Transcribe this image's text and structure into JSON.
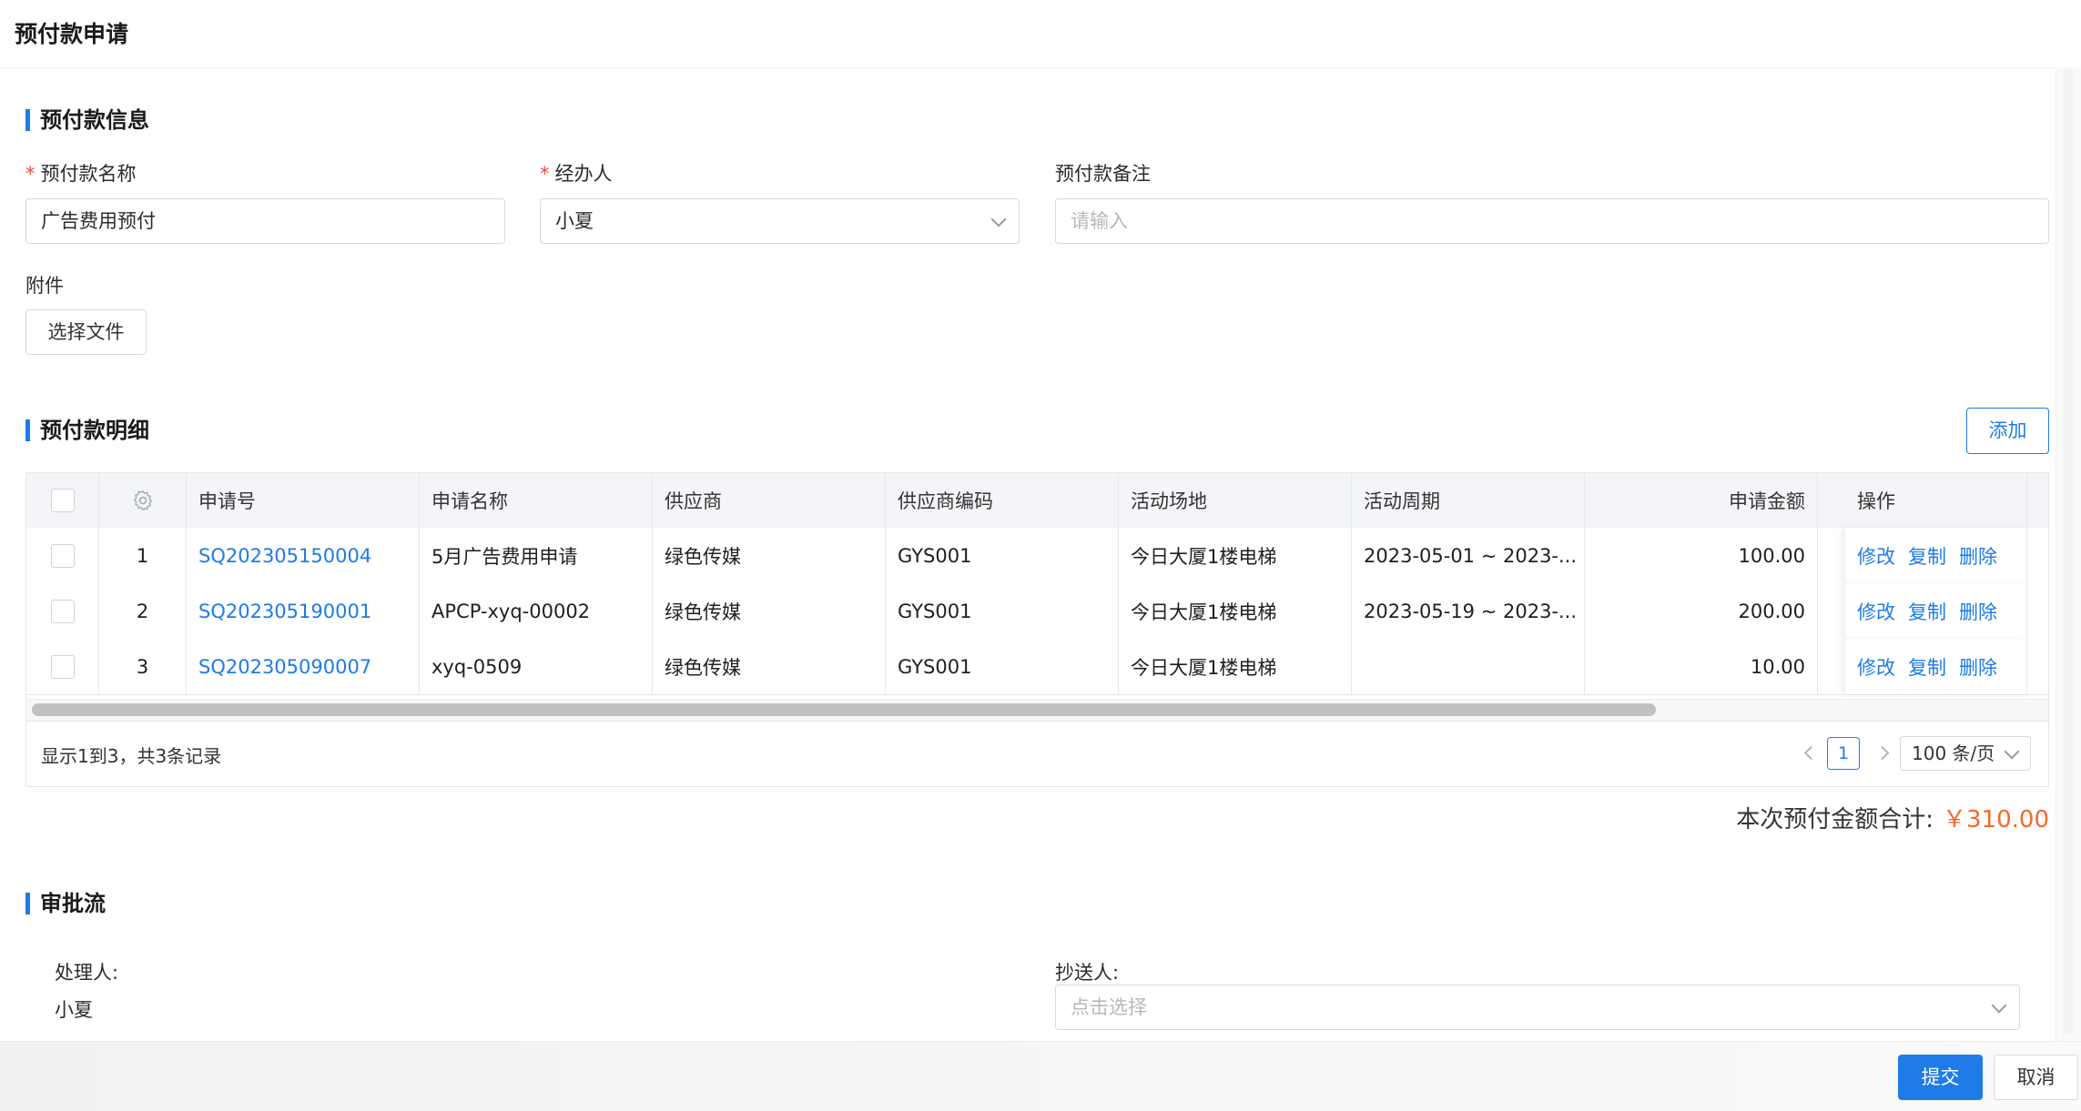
{
  "page": {
    "title": "预付款申请"
  },
  "info_section": {
    "title": "预付款信息",
    "name_label": "预付款名称",
    "name_value": "广告费用预付",
    "handler_label": "经办人",
    "handler_value": "小夏",
    "remark_label": "预付款备注",
    "remark_placeholder": "请输入",
    "attachment_label": "附件",
    "choose_file_label": "选择文件"
  },
  "detail_section": {
    "title": "预付款明细",
    "add_label": "添加",
    "columns": [
      "申请号",
      "申请名称",
      "供应商",
      "供应商编码",
      "活动场地",
      "活动周期",
      "申请金额",
      "操作"
    ],
    "rows": [
      {
        "index": "1",
        "apply_no": "SQ202305150004",
        "apply_name": "5月广告费用申请",
        "supplier": "绿色传媒",
        "supplier_code": "GYS001",
        "venue": "今日大厦1楼电梯",
        "period": "2023-05-01 ~ 2023-...",
        "amount": "100.00"
      },
      {
        "index": "2",
        "apply_no": "SQ202305190001",
        "apply_name": "APCP-xyq-00002",
        "supplier": "绿色传媒",
        "supplier_code": "GYS001",
        "venue": "今日大厦1楼电梯",
        "period": "2023-05-19 ~ 2023-...",
        "amount": "200.00"
      },
      {
        "index": "3",
        "apply_no": "SQ202305090007",
        "apply_name": "xyq-0509",
        "supplier": "绿色传媒",
        "supplier_code": "GYS001",
        "venue": "今日大厦1楼电梯",
        "period": "",
        "amount": "10.00"
      }
    ],
    "actions": [
      "修改",
      "复制",
      "删除"
    ],
    "record_summary": "显示1到3，共3条记录",
    "current_page": "1",
    "page_size": "100 条/页"
  },
  "total": {
    "label": "本次预付金额合计:",
    "amount": "￥310.00"
  },
  "approval_section": {
    "title": "审批流",
    "handler_label": "处理人:",
    "handler_value": "小夏",
    "cc_label": "抄送人:",
    "cc_placeholder": "点击选择"
  },
  "footer": {
    "submit_label": "提交",
    "cancel_label": "取消"
  }
}
